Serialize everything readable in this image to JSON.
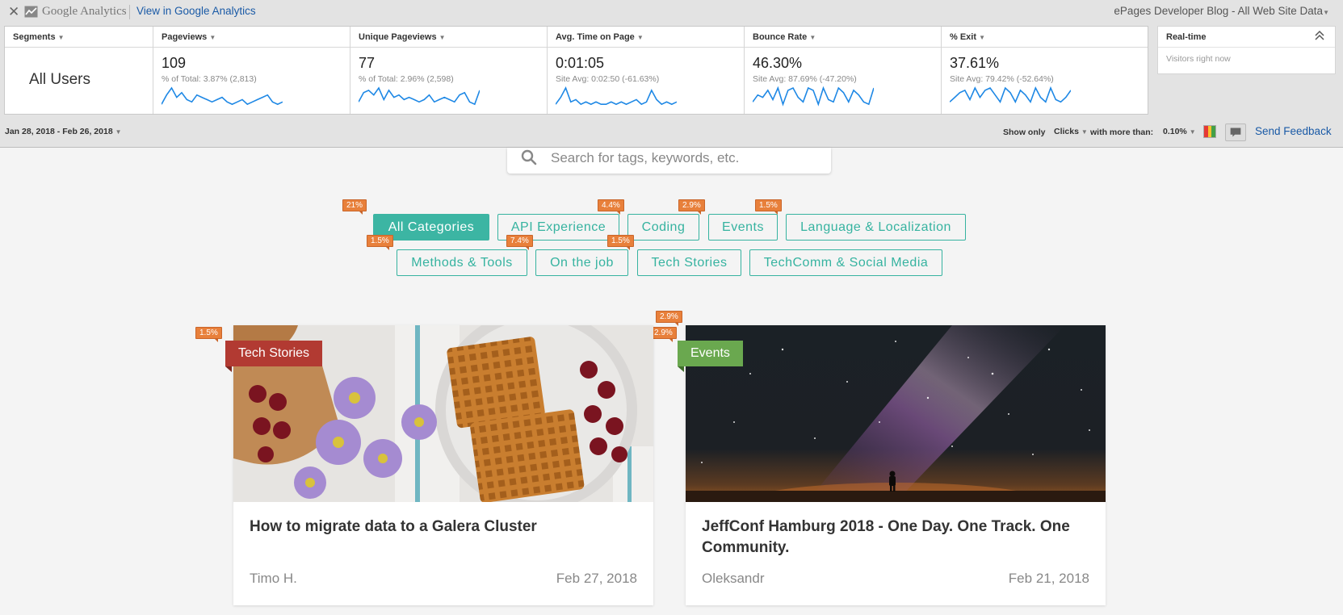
{
  "ga": {
    "close_glyph": "✕",
    "logo_text": "Google Analytics",
    "view_link": "View in Google Analytics",
    "site": "ePages Developer Blog - All Web Site Data",
    "segments": {
      "label": "Segments",
      "value": "All Users"
    },
    "metrics": [
      {
        "label": "Pageviews",
        "value": "109",
        "sub": "% of Total: 3.87% (2,813)",
        "spark": [
          2,
          6,
          9,
          5,
          7,
          4,
          3,
          6,
          5,
          4,
          3,
          4,
          5,
          3,
          2,
          3,
          4,
          2,
          3,
          4,
          5,
          6,
          3,
          2,
          3
        ]
      },
      {
        "label": "Unique Pageviews",
        "value": "77",
        "sub": "% of Total: 2.96% (2,598)",
        "spark": [
          3,
          7,
          8,
          6,
          9,
          4,
          8,
          5,
          6,
          4,
          5,
          4,
          3,
          4,
          6,
          3,
          4,
          5,
          4,
          3,
          6,
          7,
          3,
          2,
          8
        ]
      },
      {
        "label": "Avg. Time on Page",
        "value": "0:01:05",
        "sub": "Site Avg: 0:02:50 (-61.63%)",
        "spark": [
          2,
          5,
          9,
          3,
          4,
          2,
          3,
          2,
          3,
          2,
          2,
          3,
          2,
          3,
          2,
          3,
          4,
          2,
          3,
          8,
          4,
          2,
          3,
          2,
          3
        ]
      },
      {
        "label": "Bounce Rate",
        "value": "46.30%",
        "sub": "Site Avg: 87.69% (-47.20%)",
        "spark": [
          3,
          6,
          5,
          8,
          4,
          9,
          2,
          8,
          9,
          5,
          3,
          9,
          8,
          2,
          9,
          4,
          3,
          9,
          7,
          3,
          8,
          6,
          3,
          2,
          9
        ]
      },
      {
        "label": "% Exit",
        "value": "37.61%",
        "sub": "Site Avg: 79.42% (-52.64%)",
        "spark": [
          3,
          5,
          7,
          8,
          4,
          9,
          5,
          8,
          9,
          6,
          3,
          9,
          7,
          3,
          8,
          6,
          3,
          9,
          5,
          3,
          9,
          4,
          3,
          5,
          8
        ]
      }
    ],
    "realtime": {
      "label": "Real-time",
      "sub": "Visitors right now"
    },
    "date_range": "Jan 28, 2018 - Feb 26, 2018",
    "show_only": "Show only",
    "clicks": "Clicks",
    "with_more_than": "with more than:",
    "threshold": "0.10%",
    "heat_colors": [
      "#e53935",
      "#fbc02d",
      "#43a047"
    ],
    "feedback": "Send Feedback"
  },
  "search": {
    "placeholder": "Search for tags, keywords, etc."
  },
  "categories": [
    {
      "label": "All Categories",
      "active": true
    },
    {
      "label": "API Experience"
    },
    {
      "label": "Coding"
    },
    {
      "label": "Events"
    },
    {
      "label": "Language & Localization"
    },
    {
      "label": "Methods & Tools"
    },
    {
      "label": "On the job"
    },
    {
      "label": "Tech Stories"
    },
    {
      "label": "TechComm & Social Media"
    }
  ],
  "click_badges": [
    "21%",
    "4.4%",
    "2.9%",
    "1.5%",
    "1.5%",
    "7.4%",
    "1.5%",
    "1.5%",
    "2.9%",
    "2.9%"
  ],
  "cards": [
    {
      "category": "Tech Stories",
      "category_color": "#b23a32",
      "title": "How to migrate data to a Galera Cluster",
      "author": "Timo H.",
      "date": "Feb 27, 2018"
    },
    {
      "category": "Events",
      "category_color": "#6aa84f",
      "title": "JeffConf Hamburg 2018 - One Day. One Track. One Community.",
      "author": "Oleksandr",
      "date": "Feb 21, 2018"
    }
  ]
}
